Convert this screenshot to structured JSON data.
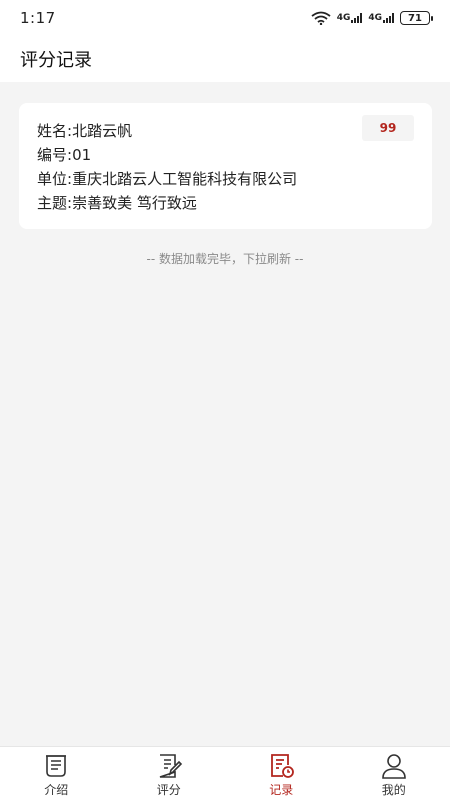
{
  "status": {
    "time": "1:17",
    "signal1": "4G",
    "signal2": "4G",
    "battery": "71"
  },
  "header": {
    "title": "评分记录"
  },
  "records": [
    {
      "name_label": "姓名:",
      "name": "北踏云帆",
      "id_label": "编号:",
      "id": "01",
      "unit_label": "单位:",
      "unit": "重庆北踏云人工智能科技有限公司",
      "theme_label": "主题:",
      "theme": "崇善致美 笃行致远",
      "score": "99"
    }
  ],
  "list_footer": "-- 数据加载完毕，下拉刷新 --",
  "tabs": [
    {
      "label": "介绍",
      "icon": "scroll-icon"
    },
    {
      "label": "评分",
      "icon": "edit-note-icon"
    },
    {
      "label": "记录",
      "icon": "record-clock-icon",
      "active": true
    },
    {
      "label": "我的",
      "icon": "user-icon"
    }
  ],
  "colors": {
    "accent": "#b3261e",
    "background": "#f4f4f4"
  }
}
